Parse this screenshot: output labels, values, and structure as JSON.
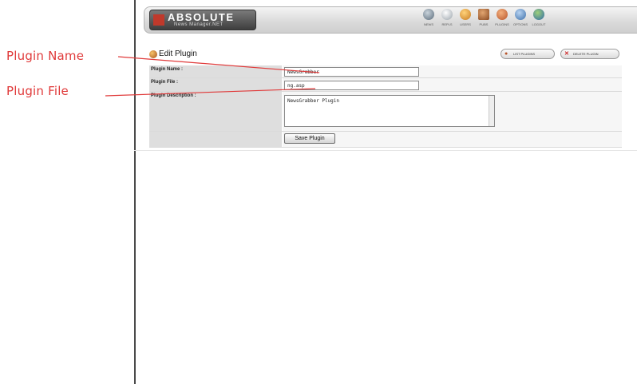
{
  "annotations": {
    "plugin_name_label": "Plugin Name",
    "plugin_file_label": "Plugin File",
    "color": "#e03a3a"
  },
  "header": {
    "logo_text": "ABSOLUTE",
    "logo_subtext": "News Manager.NET",
    "nav": [
      {
        "label": "NEWS",
        "icon": "quill-icon",
        "color": "#5a6b7a"
      },
      {
        "label": "REPLS",
        "icon": "stack-icon",
        "color": "#9aa3ab"
      },
      {
        "label": "USERS",
        "icon": "users-icon",
        "color": "#c87b22"
      },
      {
        "label": "PUBS",
        "icon": "book-icon",
        "color": "#8a4a22"
      },
      {
        "label": "PLUGINS",
        "icon": "puzzle-icon",
        "color": "#b8542a"
      },
      {
        "label": "OPTIONS",
        "icon": "options-icon",
        "color": "#3c6ea8"
      },
      {
        "label": "LOGOUT",
        "icon": "globe-icon",
        "color": "#2f6aa8"
      }
    ]
  },
  "section": {
    "title": "Edit Plugin"
  },
  "buttons": {
    "list_plugins": "LIST PLUGINS",
    "delete_plugin": "DELETE PLUGIN"
  },
  "form": {
    "plugin_name_label": "Plugin Name :",
    "plugin_name_value": "NewsGrabber",
    "plugin_file_label": "Plugin File :",
    "plugin_file_value": "ng.asp",
    "plugin_description_label": "Plugin Description :",
    "plugin_description_value": "NewsGrabber Plugin",
    "save_button": "Save Plugin"
  }
}
